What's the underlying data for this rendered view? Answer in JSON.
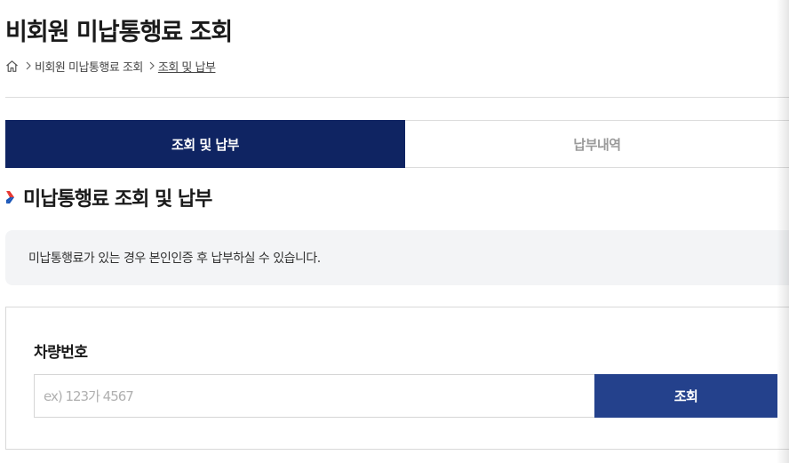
{
  "page": {
    "title": "비회원 미납통행료 조회"
  },
  "breadcrumb": {
    "home_icon": "home-icon",
    "items": [
      "비회원 미납통행료 조회",
      "조회 및 납부"
    ]
  },
  "tabs": [
    {
      "label": "조회 및 납부",
      "active": true
    },
    {
      "label": "납부내역",
      "active": false
    }
  ],
  "section": {
    "title": "미납통행료 조회 및 납부",
    "marker_colors": [
      "#e5322d",
      "#1a56b8"
    ]
  },
  "notice": {
    "text": "미납통행료가 있는 경우 본인인증 후 납부하실 수 있습니다."
  },
  "form": {
    "label": "차량번호",
    "input": {
      "placeholder": "ex) 123가 4567",
      "value": ""
    },
    "button_label": "조회"
  },
  "colors": {
    "tab_active": "#0f2462",
    "button": "#24418c"
  }
}
